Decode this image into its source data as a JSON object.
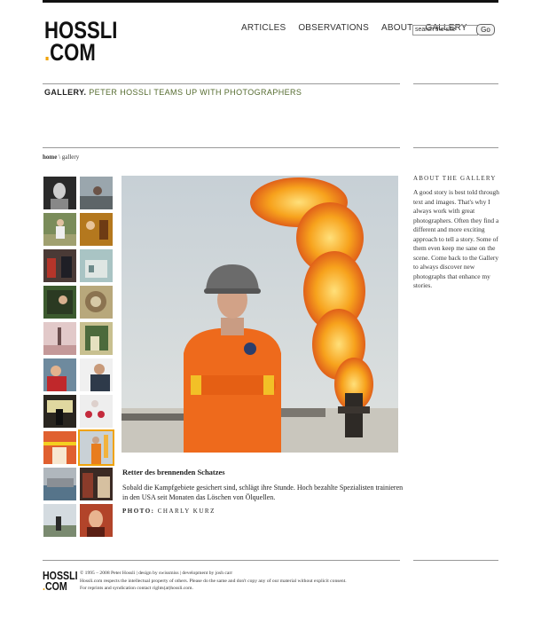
{
  "site": {
    "logo_line1": "HOSSLI",
    "logo_dot": ".",
    "logo_line2": "COM"
  },
  "nav": {
    "items": [
      "ARTICLES",
      "OBSERVATIONS",
      "ABOUT",
      "GALLERY"
    ]
  },
  "search": {
    "placeholder": "search the site",
    "value": "search the site",
    "go_label": "Go"
  },
  "header": {
    "section": "GALLERY.",
    "subtitle": "PETER HOSSLI TEAMS UP WITH PHOTOGRAPHERS"
  },
  "breadcrumb": {
    "home": "home",
    "separator": " \\ ",
    "current": "gallery"
  },
  "photo": {
    "title": "Retter des brennenden Schatzes",
    "text": "Sobald die Kampfgebiete gesichert sind, schlägt ihre Stunde. Hoch bezahlte Spezialisten trainieren in den USA seit Monaten das Löschen von Ölquellen.",
    "credit_label": "PHOTO:",
    "credit_name": "CHARLY KURZ"
  },
  "aside": {
    "heading": "ABOUT THE GALLERY",
    "text": "A good story is best told through text and images. That's why I always work with great photographers. Often they find a different and more exciting approach to tell a story. Some of them even keep me sane on the scene. Come back to the Gallery to always discover new photographs that enhance my stories."
  },
  "footer": {
    "logo_line1": "HOSSLI",
    "logo_dot": ".",
    "logo_line2": "COM",
    "line1": "© 1995 – 2008 Peter Hossli | design by swissmiss | development by josh carr",
    "line2": "Hossli.com respects the intellectual property of others. Please do the same and don't copy any of our material without explicit consent.",
    "line3": "For reprints and syndication contact rights(at)hossli.com."
  },
  "colors": {
    "accent": "#f0a30a",
    "title_green": "#556b2f"
  }
}
